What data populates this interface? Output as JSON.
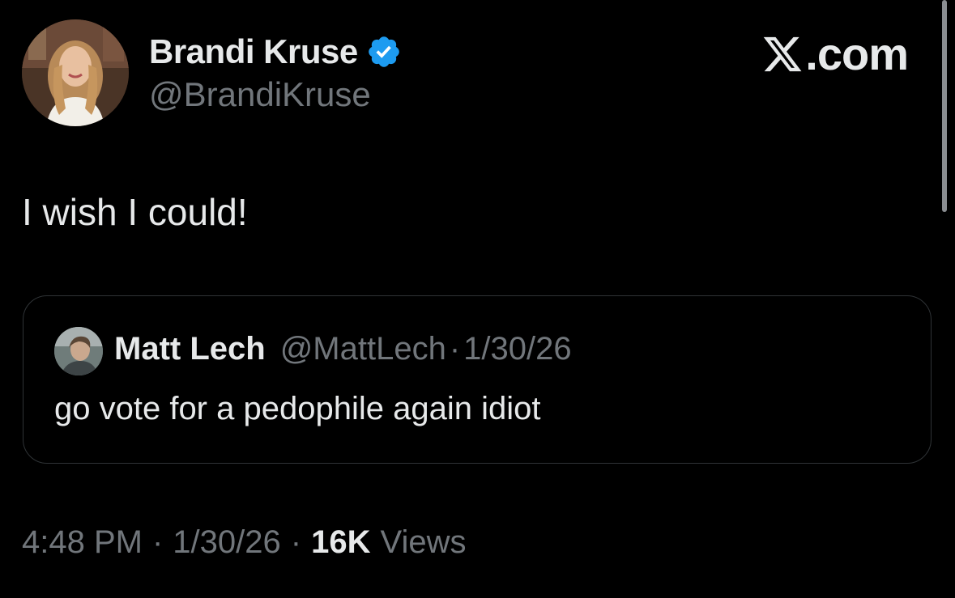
{
  "tweet": {
    "author": {
      "name": "Brandi Kruse",
      "handle": "@BrandiKruse",
      "verified": true
    },
    "text": "I wish I could!",
    "quoted": {
      "name": "Matt Lech",
      "handle": "@MattLech",
      "separator": "·",
      "date": "1/30/26",
      "text": "go vote for a pedophile again idiot"
    },
    "meta": {
      "time": "4:48 PM",
      "separator": "·",
      "date": "1/30/26",
      "views_count": "16K",
      "views_label": "Views"
    }
  },
  "brand": {
    "logo_text": ".com",
    "logo_icon": "x-logo-icon"
  },
  "colors": {
    "background": "#000000",
    "primary_text": "#e7e9ea",
    "secondary_text": "#71767b",
    "verified_blue": "#1d9bf0",
    "border": "#2f3336"
  }
}
